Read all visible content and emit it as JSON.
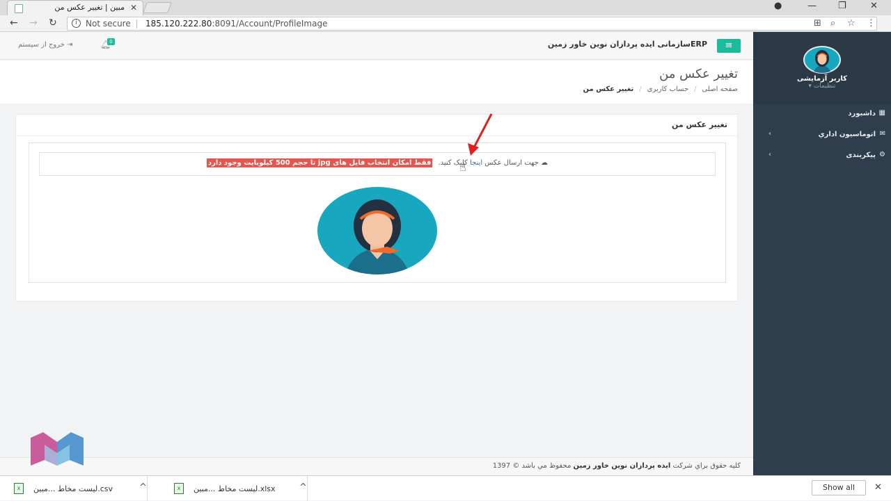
{
  "browser": {
    "tab_title": "مبين | تغيير عكس من",
    "tab_close": "✕",
    "secure_label": "Not secure",
    "url_host": "185.120.222.80",
    "url_rest": ":8091/Account/ProfileImage"
  },
  "header": {
    "brand": "ERPسازمانی ایده پردازان نوین خاور زمین",
    "logout": "خروج از سیستم",
    "notif_count": "0"
  },
  "page": {
    "title": "تغيير عكس من",
    "breadcrumb": [
      "صفحه اصلی",
      "حساب کاربری",
      "تغيير عكس من"
    ]
  },
  "card": {
    "title": "تغيير عكس من",
    "upload_prefix": "جهت ارسال عكس ",
    "upload_link": "اینجا",
    "upload_suffix": " كليک كنيد.",
    "warning": "فقط امكان انتخاب فايل های jpg تا حجم 500 كيلوبايت وجود دارد"
  },
  "footer": {
    "prefix": "كليه حقوق براي شركت ",
    "company": "ايده پردازان نوين خاور زمين",
    "suffix": " محفوظ مي باشد © 1397"
  },
  "sidebar": {
    "user_name": "کاربر آزمایشی",
    "settings": "تنظیمات",
    "items": [
      {
        "label": "داشبورد",
        "icon": "dashboard-icon",
        "has_children": false
      },
      {
        "label": "اتوماسیون اداري",
        "icon": "envelope-icon",
        "has_children": true
      },
      {
        "label": "پیکربندی",
        "icon": "cogs-icon",
        "has_children": true
      }
    ]
  },
  "downloads": {
    "items": [
      "لیست مخاط  ...مبين.csv",
      "لیست مخاط  ...مبين.xlsx"
    ],
    "show_all": "Show all"
  },
  "colors": {
    "accent": "#1abc9c",
    "sidebar": "#2f3e4c",
    "warning": "#e8554e",
    "avatar_bg": "#17a8c0"
  }
}
